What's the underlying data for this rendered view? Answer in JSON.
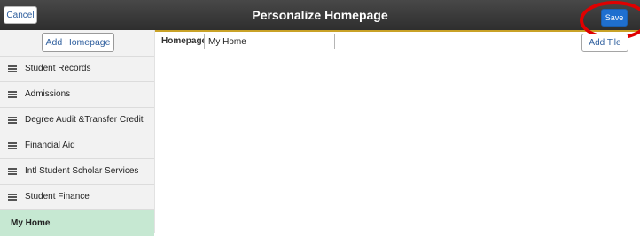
{
  "header": {
    "title": "Personalize Homepage",
    "cancel_label": "Cancel",
    "save_label": "Save",
    "bar_color": "#3a3a3a",
    "accent_color": "#c9a227",
    "highlight_color": "#e00000"
  },
  "sidebar": {
    "add_homepage_label": "Add Homepage",
    "items": [
      {
        "label": "Student Records",
        "icon": "drag-handle-icon"
      },
      {
        "label": "Admissions",
        "icon": "drag-handle-icon"
      },
      {
        "label": "Degree Audit &Transfer Credit",
        "icon": "drag-handle-icon"
      },
      {
        "label": "Financial Aid",
        "icon": "drag-handle-icon"
      },
      {
        "label": "Intl Student Scholar Services",
        "icon": "drag-handle-icon"
      },
      {
        "label": "Student Finance",
        "icon": "drag-handle-icon"
      }
    ],
    "active_item": {
      "label": "My Home"
    },
    "active_color": "#c6e8d2"
  },
  "main": {
    "homepage_label": "Homepage",
    "homepage_value": "My Home",
    "add_tile_label": "Add Tile"
  }
}
